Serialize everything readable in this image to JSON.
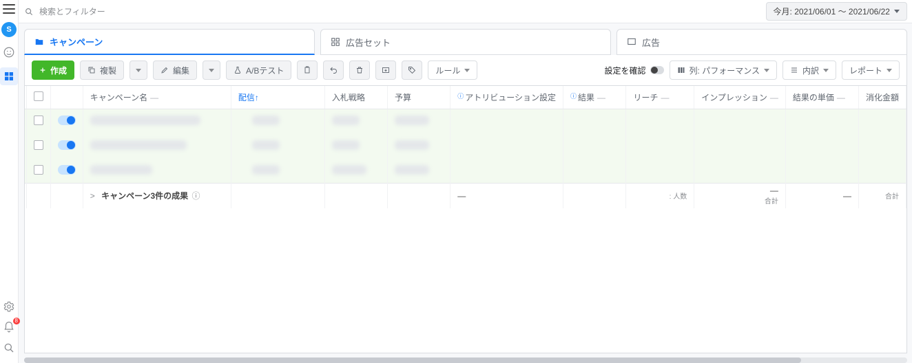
{
  "leftRail": {
    "avatar_letter": "S",
    "notif_count": "8"
  },
  "topbar": {
    "search_placeholder": "検索とフィルター",
    "date_range_label": "今月: 2021/06/01 ～ 2021/06/22"
  },
  "tabs": [
    {
      "label": "キャンペーン"
    },
    {
      "label": "広告セット"
    },
    {
      "label": "広告"
    }
  ],
  "toolbar": {
    "create_label": "作成",
    "duplicate_label": "複製",
    "edit_label": "編集",
    "abtest_label": "A/Bテスト",
    "rules_label": "ルール",
    "check_settings_label": "設定を確認",
    "columns_label": "列: パフォーマンス",
    "breakdown_label": "内訳",
    "report_label": "レポート"
  },
  "columns": {
    "campaign_name": "キャンペーン名",
    "delivery": "配信",
    "bid_strategy": "入札戦略",
    "budget": "予算",
    "attribution": "アトリビューション設定",
    "results": "結果",
    "reach": "リーチ",
    "impressions": "インプレッション",
    "cost_per_result": "結果の単価",
    "amount_spent": "消化金額",
    "delivery_sort": "↑"
  },
  "rows": [
    {
      "on": true
    },
    {
      "on": true
    },
    {
      "on": true
    }
  ],
  "summary": {
    "expand_icon": ">",
    "label": "キャンペーン3件の成果",
    "attribution_dash": "—",
    "impressions_dash": "—",
    "cost_dash": "—",
    "reach_sub": ": 人数",
    "impressions_sub": "合計",
    "amount_sub": "合計"
  }
}
